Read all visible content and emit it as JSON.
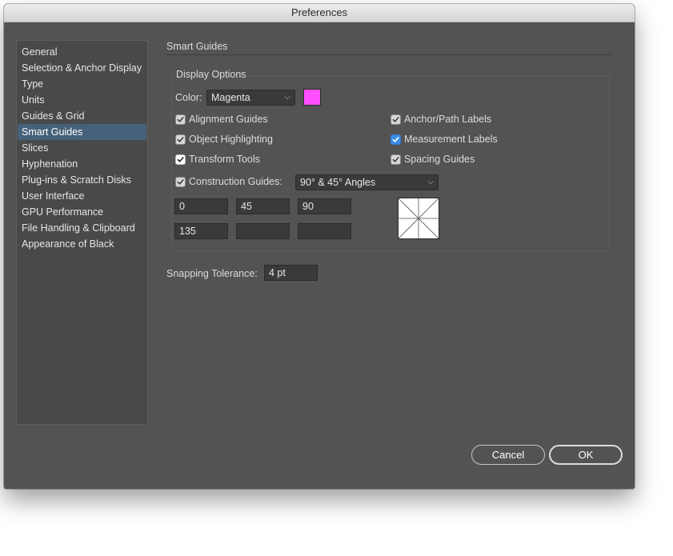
{
  "window": {
    "title": "Preferences"
  },
  "sidebar": {
    "items": [
      {
        "label": "General"
      },
      {
        "label": "Selection & Anchor Display"
      },
      {
        "label": "Type"
      },
      {
        "label": "Units"
      },
      {
        "label": "Guides & Grid"
      },
      {
        "label": "Smart Guides",
        "selected": true
      },
      {
        "label": "Slices"
      },
      {
        "label": "Hyphenation"
      },
      {
        "label": "Plug-ins & Scratch Disks"
      },
      {
        "label": "User Interface"
      },
      {
        "label": "GPU Performance"
      },
      {
        "label": "File Handling & Clipboard"
      },
      {
        "label": "Appearance of Black"
      }
    ]
  },
  "smart_guides": {
    "section_title": "Smart Guides",
    "display_options": {
      "title": "Display Options",
      "color_label": "Color:",
      "color_value": "Magenta",
      "color_swatch": "#ff4fff",
      "checkboxes": {
        "alignment_guides": {
          "label": "Alignment Guides",
          "checked": true
        },
        "object_highlighting": {
          "label": "Object Highlighting",
          "checked": true
        },
        "transform_tools": {
          "label": "Transform Tools",
          "checked": true
        },
        "anchor_path_labels": {
          "label": "Anchor/Path Labels",
          "checked": true
        },
        "measurement_labels": {
          "label": "Measurement Labels",
          "checked": true
        },
        "spacing_guides": {
          "label": "Spacing Guides",
          "checked": true
        },
        "construction_guides": {
          "label": "Construction Guides:",
          "checked": true
        }
      },
      "construction_angles": "90° & 45° Angles",
      "angle_fields": [
        "0",
        "45",
        "90",
        "135",
        "",
        ""
      ]
    },
    "snapping_tolerance_label": "Snapping Tolerance:",
    "snapping_tolerance_value": "4 pt"
  },
  "buttons": {
    "cancel": "Cancel",
    "ok": "OK"
  },
  "icons": {
    "dropdown": "chevron-down-icon",
    "check": "checkmark-icon"
  }
}
